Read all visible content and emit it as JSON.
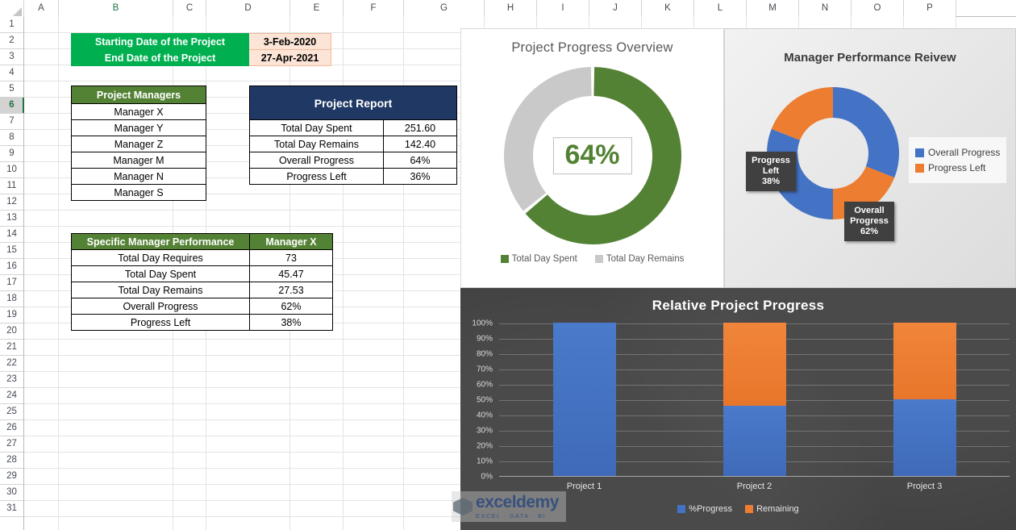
{
  "spreadsheet": {
    "columns": [
      "A",
      "B",
      "C",
      "D",
      "E",
      "F",
      "G",
      "H",
      "I",
      "J",
      "K",
      "L",
      "M",
      "N",
      "O",
      "P"
    ],
    "rows": [
      1,
      2,
      3,
      4,
      5,
      6,
      7,
      8,
      9,
      10,
      11,
      12,
      13,
      14,
      15,
      16,
      17,
      18,
      19,
      20,
      21,
      22,
      23,
      24,
      25,
      26,
      27,
      28,
      29,
      30,
      31
    ],
    "selected_row": 6,
    "selected_column": "B"
  },
  "date_block": {
    "rows": [
      {
        "label": "Starting Date of the Project",
        "value": "3-Feb-2020"
      },
      {
        "label": "End Date of the Project",
        "value": "27-Apr-2021"
      }
    ]
  },
  "managers_table": {
    "header": "Project Managers",
    "items": [
      "Manager X",
      "Manager Y",
      "Manager Z",
      "Manager M",
      "Manager N",
      "Manager S"
    ]
  },
  "project_report": {
    "header": "Project Report",
    "rows": [
      {
        "label": "Total Day Spent",
        "value": "251.60"
      },
      {
        "label": "Total Day Remains",
        "value": "142.40"
      },
      {
        "label": "Overall Progress",
        "value": "64%"
      },
      {
        "label": "Progress Left",
        "value": "36%"
      }
    ]
  },
  "manager_performance": {
    "header_label": "Specific Manager Performance",
    "header_value": "Manager X",
    "rows": [
      {
        "label": "Total Day Requires",
        "value": "73"
      },
      {
        "label": "Total Day Spent",
        "value": "45.47"
      },
      {
        "label": "Total Day Remains",
        "value": "27.53"
      },
      {
        "label": "Overall Progress",
        "value": "62%"
      },
      {
        "label": "Progress Left",
        "value": "38%"
      }
    ]
  },
  "watermark": {
    "main": "exceldemy",
    "sub": "EXCEL · DATA · BI"
  },
  "chart_data": [
    {
      "id": "project_progress_overview",
      "type": "pie",
      "title": "Project Progress Overview",
      "center_label": "64%",
      "legend_position": "bottom",
      "labels": [
        "Total Day Spent",
        "Total Day Remains"
      ],
      "values": [
        64,
        36
      ],
      "colors": [
        "#548235",
        "#c9c9c9"
      ]
    },
    {
      "id": "manager_performance_review",
      "type": "pie",
      "title": "Manager Performance Reivew",
      "legend_position": "right",
      "labels": [
        "Overall Progress",
        "Progress Left"
      ],
      "values": [
        62,
        38
      ],
      "colors": [
        "#4472c4",
        "#ed7d31"
      ],
      "data_labels": [
        {
          "name": "Progress Left",
          "value": "38%"
        },
        {
          "name": "Overall Progress",
          "value": "62%"
        }
      ]
    },
    {
      "id": "relative_project_progress",
      "type": "bar",
      "title": "Relative Project Progress",
      "stacked": true,
      "categories": [
        "Project 1",
        "Project 2",
        "Project 3"
      ],
      "series": [
        {
          "name": "%Progress",
          "values": [
            100,
            46,
            50
          ],
          "color": "#4472c4"
        },
        {
          "name": "Remaining",
          "values": [
            0,
            54,
            50
          ],
          "color": "#ed7d31"
        }
      ],
      "ylim": [
        0,
        100
      ],
      "yticks": [
        "100%",
        "90%",
        "80%",
        "70%",
        "60%",
        "50%",
        "40%",
        "30%",
        "20%",
        "10%",
        "0%"
      ],
      "ylabel": "",
      "xlabel": "",
      "grid": true,
      "legend_position": "bottom"
    }
  ]
}
